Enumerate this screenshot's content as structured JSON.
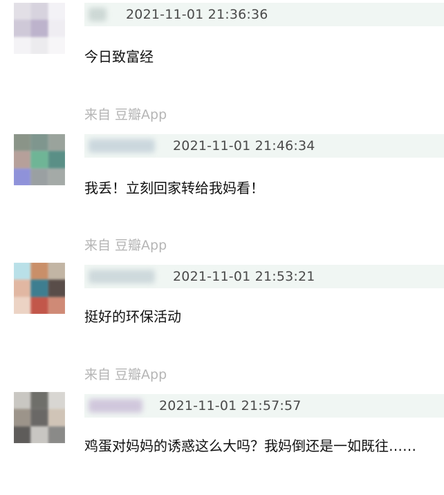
{
  "comments": [
    {
      "timestamp": "2021-11-01 21:36:36",
      "text": "今日致富经",
      "source": "来自 豆瓣App",
      "avatar_colors": [
        "#e2dfe6",
        "#d7d3de",
        "#f3f2f6",
        "#cfc9d8",
        "#bdb3cc",
        "#efedf2",
        "#f4f3f6",
        "#ecebee",
        "#f7f6f8"
      ]
    },
    {
      "timestamp": "2021-11-01 21:46:34",
      "text": "我丢！立刻回家转给我妈看！",
      "source": "来自 豆瓣App",
      "avatar_colors": [
        "#8a9488",
        "#7f968e",
        "#9aa39c",
        "#b6a09a",
        "#6fb596",
        "#5a8f86",
        "#8f92d9",
        "#9aa0a2",
        "#a4aaa7"
      ]
    },
    {
      "timestamp": "2021-11-01 21:53:21",
      "text": "挺好的环保活动",
      "source": "来自 豆瓣App",
      "avatar_colors": [
        "#b9e0e8",
        "#c98f69",
        "#c2b5a4",
        "#e1b7a2",
        "#3e7e90",
        "#594d49",
        "#ecd3c4",
        "#c2574a",
        "#cf8a76"
      ]
    },
    {
      "timestamp": "2021-11-01 21:57:57",
      "text": "鸡蛋对妈妈的诱惑这么大吗？我妈倒还是一如既往……",
      "source": null,
      "avatar_colors": [
        "#c9c7c2",
        "#6f6f6a",
        "#d8d6d2",
        "#9c948a",
        "#6a6866",
        "#d0c4b7",
        "#5e5c5a",
        "#c8c6c2",
        "#8a8a88"
      ]
    }
  ]
}
